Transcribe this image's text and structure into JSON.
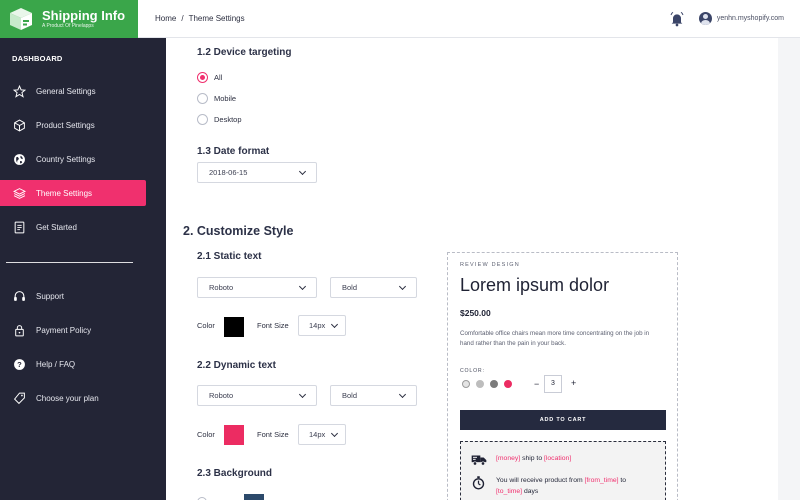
{
  "brand": {
    "name": "Shipping Info",
    "subtitle": "A Product Of Pinelapps"
  },
  "sidebar": {
    "section_title": "DASHBOARD",
    "items": [
      {
        "label": "General Settings",
        "icon": "star-icon"
      },
      {
        "label": "Product Settings",
        "icon": "box-icon"
      },
      {
        "label": "Country Settings",
        "icon": "globe-icon"
      },
      {
        "label": "Theme Settings",
        "icon": "layers-icon",
        "active": true
      },
      {
        "label": "Get Started",
        "icon": "document-icon"
      }
    ],
    "items2": [
      {
        "label": "Support",
        "icon": "headset-icon"
      },
      {
        "label": "Payment Policy",
        "icon": "lock-icon"
      },
      {
        "label": "Help / FAQ",
        "icon": "question-icon"
      },
      {
        "label": "Choose your plan",
        "icon": "tag-icon"
      }
    ]
  },
  "topbar": {
    "breadcrumb": [
      "Home",
      "Theme Settings"
    ],
    "separator": "/",
    "shop": "yenhn.myshopify.com"
  },
  "device": {
    "title": "1.2 Device targeting",
    "options": [
      "All",
      "Mobile",
      "Desktop"
    ],
    "selected": "All"
  },
  "date_format": {
    "title": "1.3 Date format",
    "value": "2018-06-15"
  },
  "customize": {
    "title": "2. Customize Style",
    "static": {
      "title": "2.1 Static text",
      "font": "Roboto",
      "weight": "Bold",
      "color_label": "Color",
      "color": "#000000",
      "size_label": "Font Size",
      "size": "14px"
    },
    "dynamic": {
      "title": "2.2 Dynamic text",
      "font": "Roboto",
      "weight": "Bold",
      "color_label": "Color",
      "color": "#ec2c62",
      "size_label": "Font Size",
      "size": "14px"
    },
    "background": {
      "title": "2.3 Background"
    }
  },
  "preview": {
    "label": "REVIEW DESIGN",
    "product_title": "Lorem ipsum dolor",
    "price": "$250.00",
    "description": "Comfortable office chairs mean more time concentrating on the job in hand rather than the pain in your back.",
    "color_label": "COLOR:",
    "colors": [
      "#e4e4e4",
      "#bdbdbd",
      "#7b7b7b",
      "#ec2c62"
    ],
    "qty_minus": "−",
    "qty": "3",
    "qty_plus": "+",
    "add_to_cart": "ADD TO CART",
    "ship_line1": {
      "money": "[money]",
      "mid": " ship to ",
      "location": "[location]"
    },
    "ship_line2": {
      "pre": "You will receive product from ",
      "from": "[from_time]",
      "to_word": " to",
      "to": "[to_time]",
      "post": " days"
    }
  }
}
